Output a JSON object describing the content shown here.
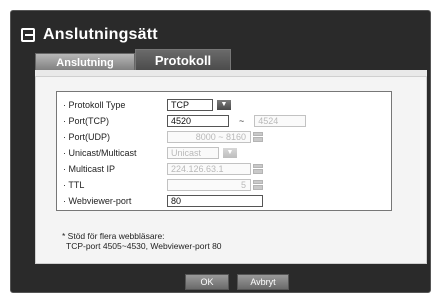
{
  "window": {
    "title": "Anslutningsätt"
  },
  "tabs": [
    {
      "label": "Anslutning"
    },
    {
      "label": "Protokoll"
    }
  ],
  "settings": {
    "protocol_type": {
      "label": "· Protokoll Type",
      "value": "TCP"
    },
    "port_tcp": {
      "label": "· Port(TCP)",
      "value": "4520",
      "end_value": "4524",
      "separator": "~"
    },
    "port_udp": {
      "label": "· Port(UDP)",
      "value": "8000 ~ 8160"
    },
    "unicast_multicast": {
      "label": "· Unicast/Multicast",
      "value": "Unicast"
    },
    "multicast_ip": {
      "label": "· Multicast IP",
      "value": "224.126.63.1"
    },
    "ttl": {
      "label": "· TTL",
      "value": "5"
    },
    "webviewer_port": {
      "label": "· Webviewer-port",
      "value": "80"
    }
  },
  "note": {
    "line1": "* Stöd för flera webbläsare:",
    "line2": "TCP-port 4505~4530, Webviewer-port 80"
  },
  "buttons": {
    "ok": "OK",
    "cancel": "Avbryt"
  }
}
